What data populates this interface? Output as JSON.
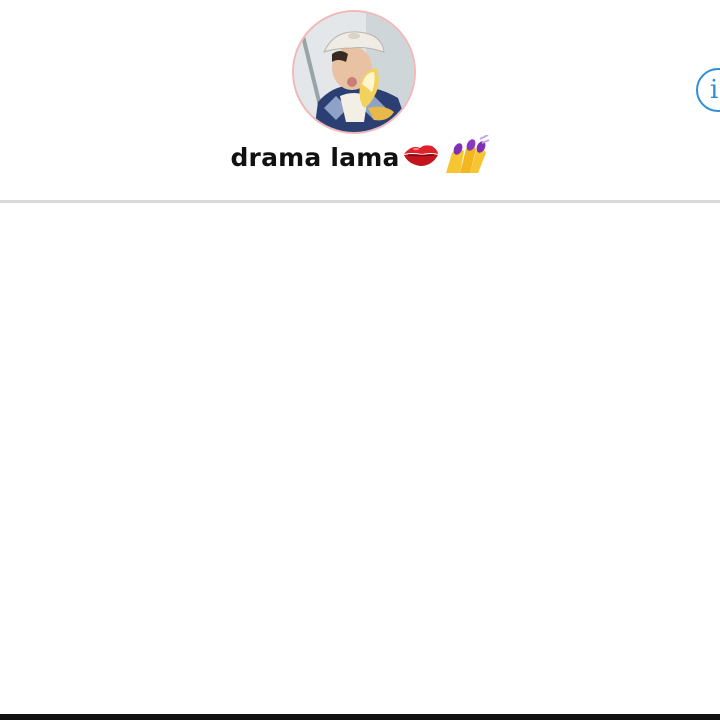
{
  "chat": {
    "title": "drama lama",
    "avatar": "profile-photo",
    "info_icon": "info-icon",
    "title_emojis": [
      "kiss-mark-icon",
      "nail-polish-icon"
    ]
  },
  "colors": {
    "avatar_ring": "#f1b8b8",
    "info_accent": "#2f8fd6",
    "divider": "#d9d9d9",
    "title_text": "#111111"
  }
}
